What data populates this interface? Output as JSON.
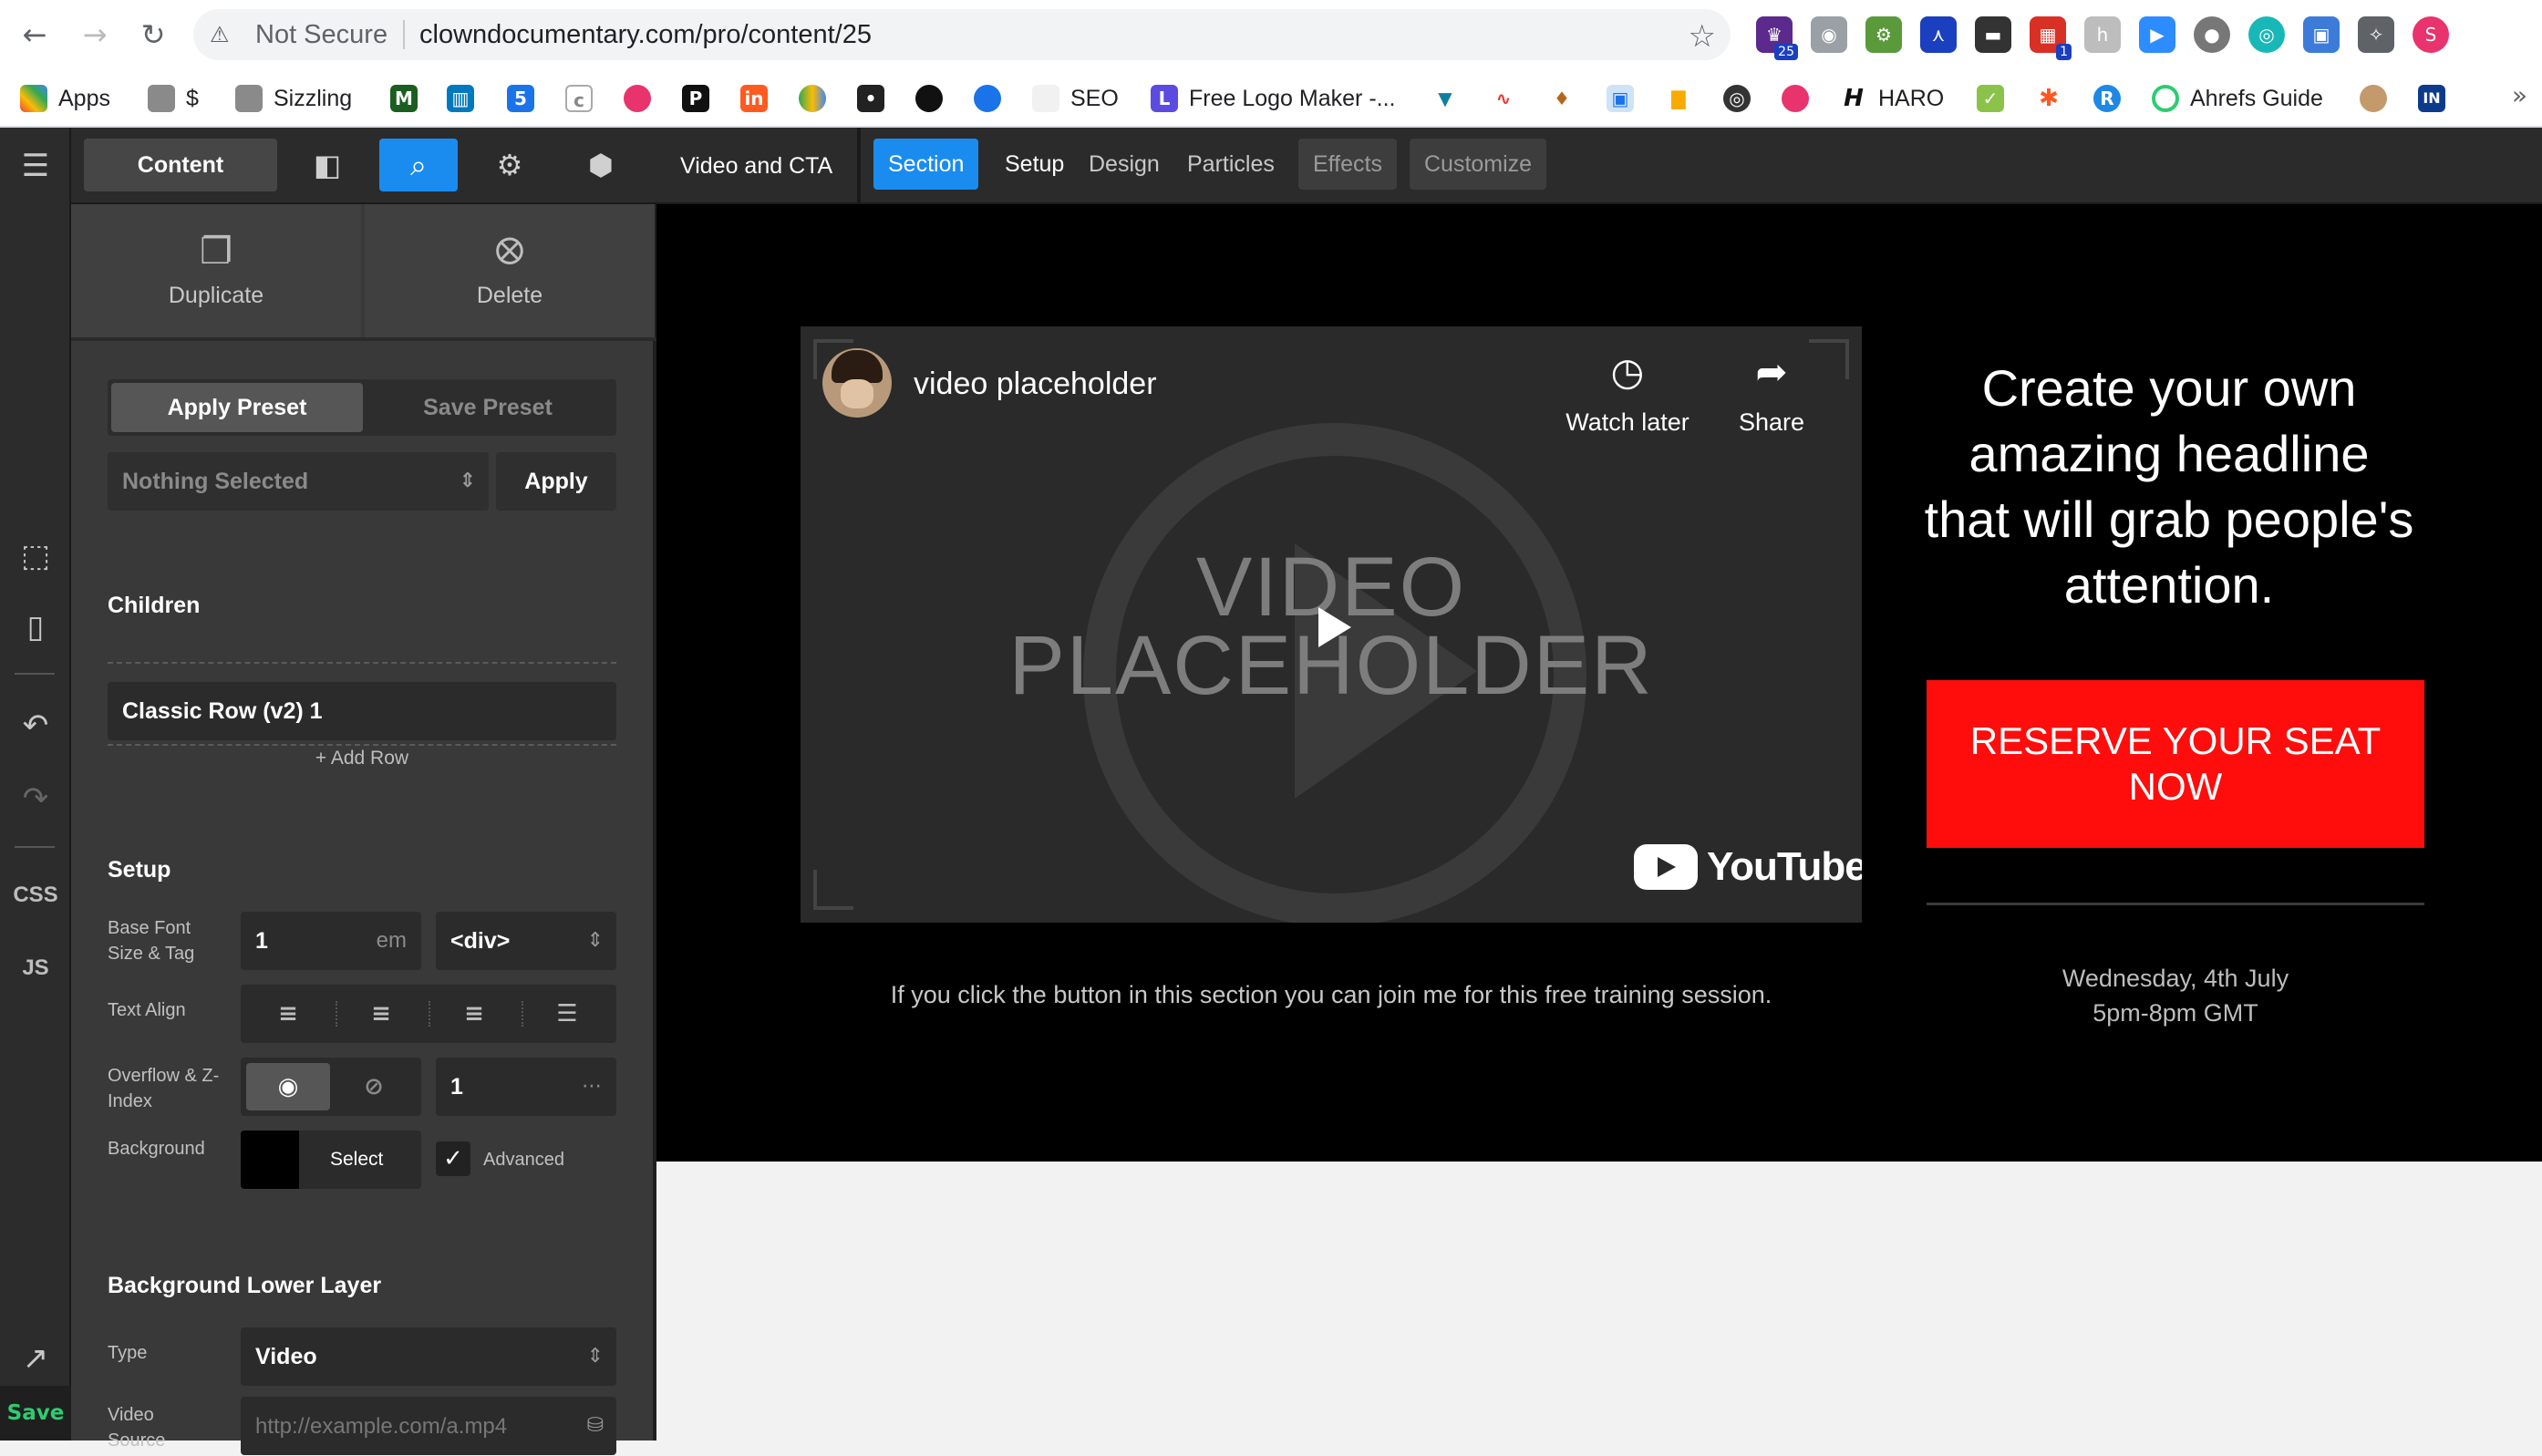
{
  "browser": {
    "not_secure": "Not Secure",
    "url": "clowndocumentary.com/pro/content/25",
    "extension_badges": [
      "25",
      "1"
    ]
  },
  "bookmarks": [
    {
      "label": "Apps",
      "icon": "apps-grid-icon"
    },
    {
      "label": "$",
      "icon": "folder-icon"
    },
    {
      "label": "Sizzling",
      "icon": "folder-icon"
    },
    {
      "label": "",
      "icon": "m-logo-icon"
    },
    {
      "label": "",
      "icon": "trello-icon"
    },
    {
      "label": "",
      "icon": "calendar-5-icon"
    },
    {
      "label": "",
      "icon": "c-icon"
    },
    {
      "label": "",
      "icon": "pink-badge-icon"
    },
    {
      "label": "",
      "icon": "p-icon"
    },
    {
      "label": "",
      "icon": "in-icon"
    },
    {
      "label": "",
      "icon": "drive-icon"
    },
    {
      "label": "",
      "icon": "red-dot-icon"
    },
    {
      "label": "",
      "icon": "circle-icon"
    },
    {
      "label": "",
      "icon": "chat-icon"
    },
    {
      "label": "SEO",
      "icon": "blank-icon"
    },
    {
      "label": "Free Logo Maker -...",
      "icon": "logo-maker-icon"
    },
    {
      "label": "",
      "icon": "vee-icon"
    },
    {
      "label": "",
      "icon": "pulse-icon"
    },
    {
      "label": "",
      "icon": "deer-icon"
    },
    {
      "label": "",
      "icon": "robot-icon"
    },
    {
      "label": "",
      "icon": "bars-icon"
    },
    {
      "label": "",
      "icon": "globe-icon"
    },
    {
      "label": "",
      "icon": "pink-badge-icon"
    },
    {
      "label": "HARO",
      "icon": "h-icon"
    },
    {
      "label": "",
      "icon": "check-icon"
    },
    {
      "label": "",
      "icon": "asterisk-icon"
    },
    {
      "label": "",
      "icon": "r-icon"
    },
    {
      "label": "Ahrefs Guide",
      "icon": "ring-icon"
    },
    {
      "label": "",
      "icon": "avatar-icon"
    },
    {
      "label": "",
      "icon": "in-box-icon"
    }
  ],
  "rail": {
    "css": "CSS",
    "js": "JS",
    "save": "Save"
  },
  "panel": {
    "tab_content": "Content",
    "duplicate": "Duplicate",
    "delete": "Delete",
    "apply_preset": "Apply Preset",
    "save_preset": "Save Preset",
    "preset_select": "Nothing Selected",
    "apply": "Apply",
    "children_label": "Children",
    "child_row": "Classic Row (v2) 1",
    "add_row": "+ Add Row",
    "setup_label": "Setup",
    "base_font_label": "Base Font Size & Tag",
    "base_font_value": "1",
    "base_font_unit": "em",
    "tag_value": "<div>",
    "text_align_label": "Text Align",
    "overflow_label": "Overflow & Z-Index",
    "z_index_value": "1",
    "background_label": "Background",
    "background_color": "#000000",
    "select_label": "Select",
    "advanced_label": "Advanced",
    "advanced_checked": true,
    "bg_lower_label": "Background Lower Layer",
    "type_label": "Type",
    "type_value": "Video",
    "video_source_label": "Video Source",
    "video_source_placeholder": "http://example.com/a.mp4"
  },
  "toolbar": {
    "element_title": "Video and CTA",
    "section": "Section",
    "setup": "Setup",
    "design": "Design",
    "particles": "Particles",
    "effects": "Effects",
    "customize": "Customize"
  },
  "content": {
    "video_title": "video placeholder",
    "watch_later": "Watch later",
    "share": "Share",
    "placeholder_line1": "VIDEO",
    "placeholder_line2": "PLACEHOLDER",
    "youtube": "YouTube",
    "caption": "If you click the button in this section you can join me for this free training session.",
    "headline": "Create your own amazing headline that will grab people's attention.",
    "cta": "RESERVE YOUR SEAT NOW",
    "cta_color": "#ff0d0d",
    "date_line1": "Wednesday, 4th July",
    "date_line2": "5pm-8pm GMT"
  },
  "colors": {
    "accent": "#1a8cf0",
    "panel_bg": "#393939",
    "save_green": "#2ecc71"
  }
}
